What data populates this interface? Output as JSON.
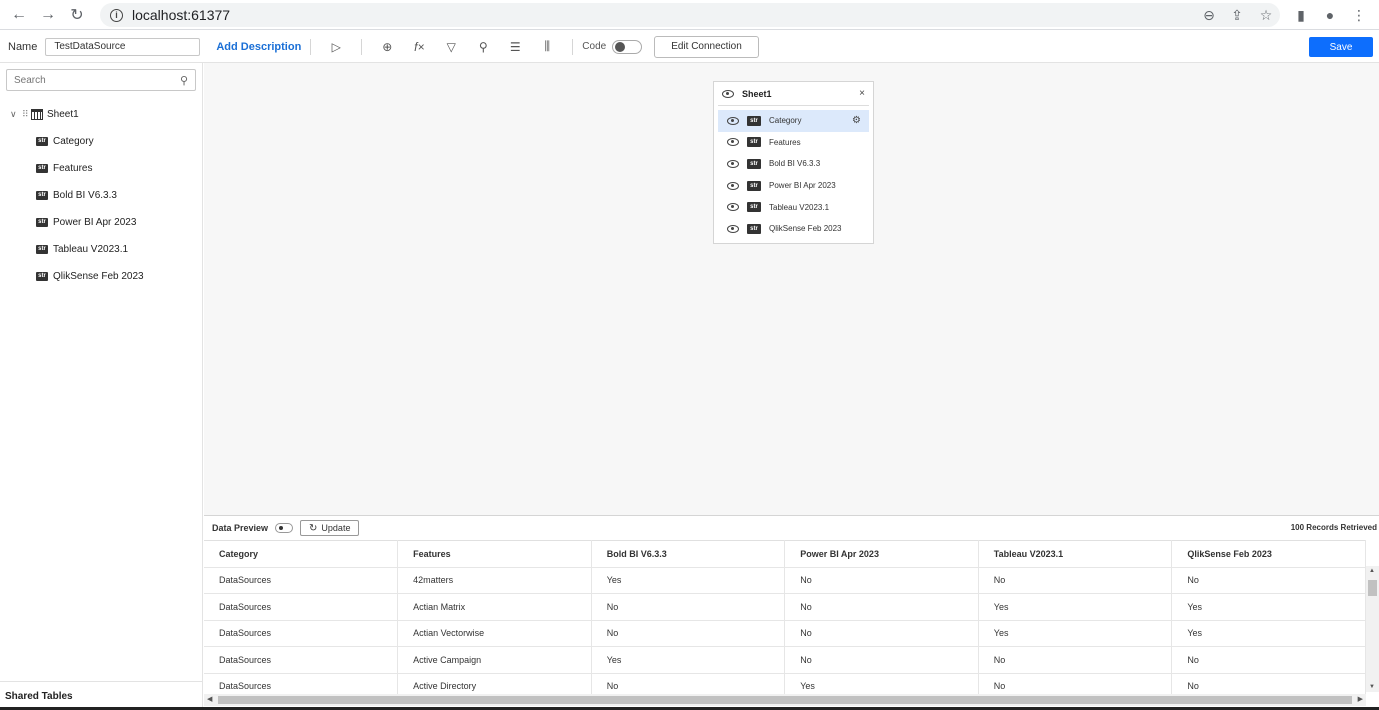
{
  "browser": {
    "url": "localhost:61377",
    "icons": [
      "back-arrow-icon",
      "forward-arrow-icon",
      "reload-icon",
      "info-icon",
      "zoom-icon",
      "share-icon",
      "star-icon",
      "sidepanel-icon",
      "profile-icon",
      "menu-icon"
    ]
  },
  "toolbar": {
    "name_label": "Name",
    "name_value": "TestDataSource",
    "add_description": "Add Description",
    "code_label": "Code",
    "code_enabled": false,
    "edit_connection": "Edit Connection",
    "save": "Save",
    "icons": [
      "run-icon",
      "join-icon",
      "function-icon",
      "filter-icon",
      "user-filter-icon",
      "properties-icon",
      "parameters-icon"
    ]
  },
  "sidebar": {
    "search_placeholder": "Search",
    "table": "Sheet1",
    "fields": [
      "Category",
      "Features",
      "Bold BI V6.3.3",
      "Power BI Apr 2023",
      "Tableau V2023.1",
      "QlikSense Feb 2023"
    ],
    "type_badge": "str",
    "shared_tables": "Shared Tables"
  },
  "sheet_card": {
    "title": "Sheet1",
    "close": "×",
    "selected_field": "Category",
    "fields": [
      "Category",
      "Features",
      "Bold BI V6.3.3",
      "Power BI Apr 2023",
      "Tableau V2023.1",
      "QlikSense Feb 2023"
    ],
    "type_badge": "str"
  },
  "preview": {
    "label": "Data Preview",
    "update": "Update",
    "records": "100 Records Retrieved",
    "columns": [
      "Category",
      "Features",
      "Bold BI V6.3.3",
      "Power BI Apr 2023",
      "Tableau V2023.1",
      "QlikSense Feb 2023"
    ],
    "rows": [
      [
        "DataSources",
        "42matters",
        "Yes",
        "No",
        "No",
        "No"
      ],
      [
        "DataSources",
        "Actian Matrix",
        "No",
        "No",
        "Yes",
        "Yes"
      ],
      [
        "DataSources",
        "Actian Vectorwise",
        "No",
        "No",
        "Yes",
        "Yes"
      ],
      [
        "DataSources",
        "Active Campaign",
        "Yes",
        "No",
        "No",
        "No"
      ],
      [
        "DataSources",
        "Active Directory",
        "No",
        "Yes",
        "No",
        "No"
      ]
    ]
  },
  "colors": {
    "accent": "#0d6efd",
    "link": "#1a6fd6",
    "selected_row": "#dce9fb",
    "canvas": "#f7f7f7"
  }
}
